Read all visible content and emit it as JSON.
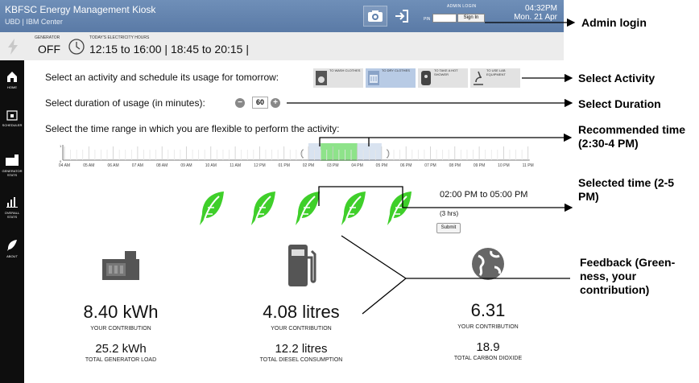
{
  "header": {
    "title": "KBFSC Energy Management Kiosk",
    "subtitle": "UBD | IBM Center",
    "admin_label": "ADMIN LOGIN",
    "pin_label": "PIN",
    "signin_label": "Sign In",
    "time": "04:32PM",
    "date": "Mon. 21 Apr"
  },
  "status": {
    "generator_label": "GENERATOR",
    "generator_value": "OFF",
    "hours_label": "TODAY'S ELECTRICITY HOURS",
    "hours_value": "12:15 to 16:00 | 18:45 to 20:15 |"
  },
  "sidebar": [
    {
      "label": "HOME",
      "icon": "home-icon"
    },
    {
      "label": "SCHEDULER",
      "icon": "calendar-icon"
    },
    {
      "label": "GENERATOR STATS",
      "icon": "generator-icon"
    },
    {
      "label": "OVERALL STATS",
      "icon": "chart-icon"
    },
    {
      "label": "ABOUT",
      "icon": "leaf-icon"
    }
  ],
  "scheduler": {
    "activity_prompt": "Select an activity and schedule its usage for tomorrow:",
    "activities": [
      {
        "label": "TO WASH CLOTHES",
        "selected": false
      },
      {
        "label": "TO DRY CLOTHES",
        "selected": true
      },
      {
        "label": "TO TAKE A HOT SHOWER",
        "selected": false
      },
      {
        "label": "TO USE LAB EQUIPMENT",
        "selected": false
      }
    ],
    "duration_prompt": "Select duration of usage (in minutes):",
    "duration_value": "60",
    "range_prompt": "Select the time range in which you are flexible to perform the activity:",
    "timeline_labels": [
      "04 AM",
      "05 AM",
      "06 AM",
      "07 AM",
      "08 AM",
      "09 AM",
      "10 AM",
      "11 AM",
      "12 PM",
      "01 PM",
      "02 PM",
      "03 PM",
      "04 PM",
      "05 PM",
      "06 PM",
      "07 PM",
      "08 PM",
      "09 PM",
      "10 PM",
      "11 PM"
    ],
    "timeline_min": "0",
    "timeline_max": "1",
    "recommended_range": [
      14.5,
      16
    ],
    "selected_range": [
      14,
      17
    ],
    "selected_text": "02:00 PM to 05:00 PM",
    "hours_text": "(3 hrs)",
    "submit_label": "Submit",
    "leaf_count": 5
  },
  "feedback": [
    {
      "icon": "generator-icon",
      "value": "8.40 kWh",
      "caption": "YOUR CONTRIBUTION",
      "total": "25.2 kWh",
      "total_caption": "TOTAL GENERATOR LOAD"
    },
    {
      "icon": "fuel-pump-icon",
      "value": "4.08 litres",
      "caption": "YOUR CONTRIBUTION",
      "total": "12.2 litres",
      "total_caption": "TOTAL DIESEL CONSUMPTION"
    },
    {
      "icon": "globe-icon",
      "value": "6.31",
      "caption": "YOUR CONTRIBUTION",
      "total": "18.9",
      "total_caption": "TOTAL CARBON DIOXIDE"
    }
  ],
  "annotations": {
    "admin": "Admin login",
    "activity": "Select Activity",
    "duration": "Select Duration",
    "recommended": "Recommended time (2:30-4 PM)",
    "selected": "Selected time (2-5 PM)",
    "feedback": "Feedback (Green-ness, your contribution)"
  },
  "colors": {
    "header": "#5f80ac",
    "recommended": "#8ee38a",
    "selected": "#d9e3f0",
    "leaf": "#3fcf2a"
  }
}
